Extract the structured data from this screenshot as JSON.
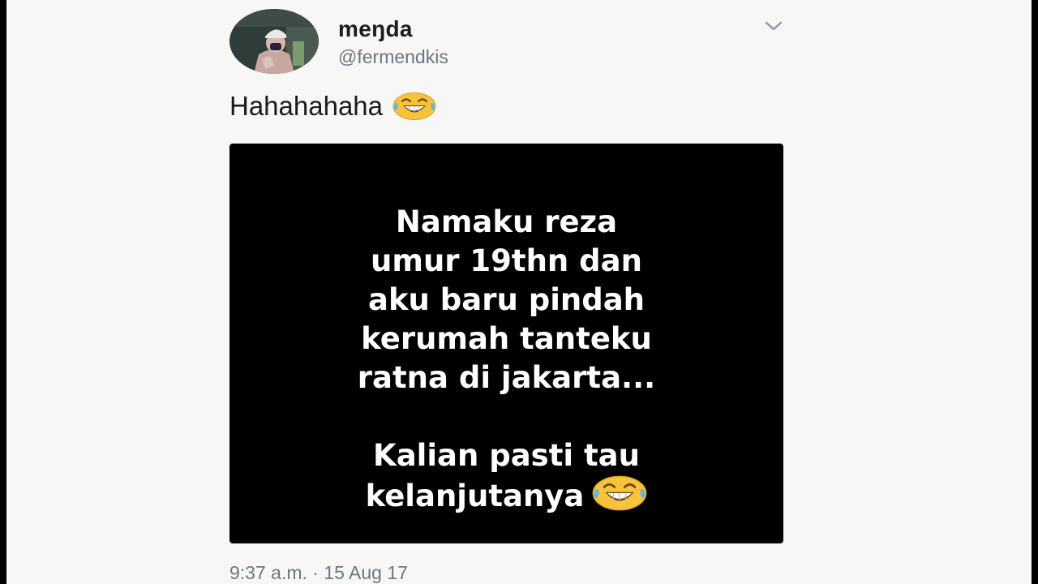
{
  "tweet": {
    "display_name": "meŋda",
    "handle": "@fermendkis",
    "text": "Hahahahaha",
    "timestamp": "9:37 a.m. · 15 Aug 17"
  },
  "media": {
    "lines": [
      "Namaku reza",
      "umur 19thn dan",
      "aku baru pindah",
      "kerumah tanteku",
      "ratna di jakarta...",
      "Kalian pasti tau",
      "kelanjutanya"
    ]
  },
  "icons": {
    "menu": "chevron-down-icon",
    "emoji": "tears-of-joy-emoji-icon"
  },
  "colors": {
    "background": "#f7f7f6",
    "media_background": "#000000",
    "muted_text": "#6d7780"
  }
}
